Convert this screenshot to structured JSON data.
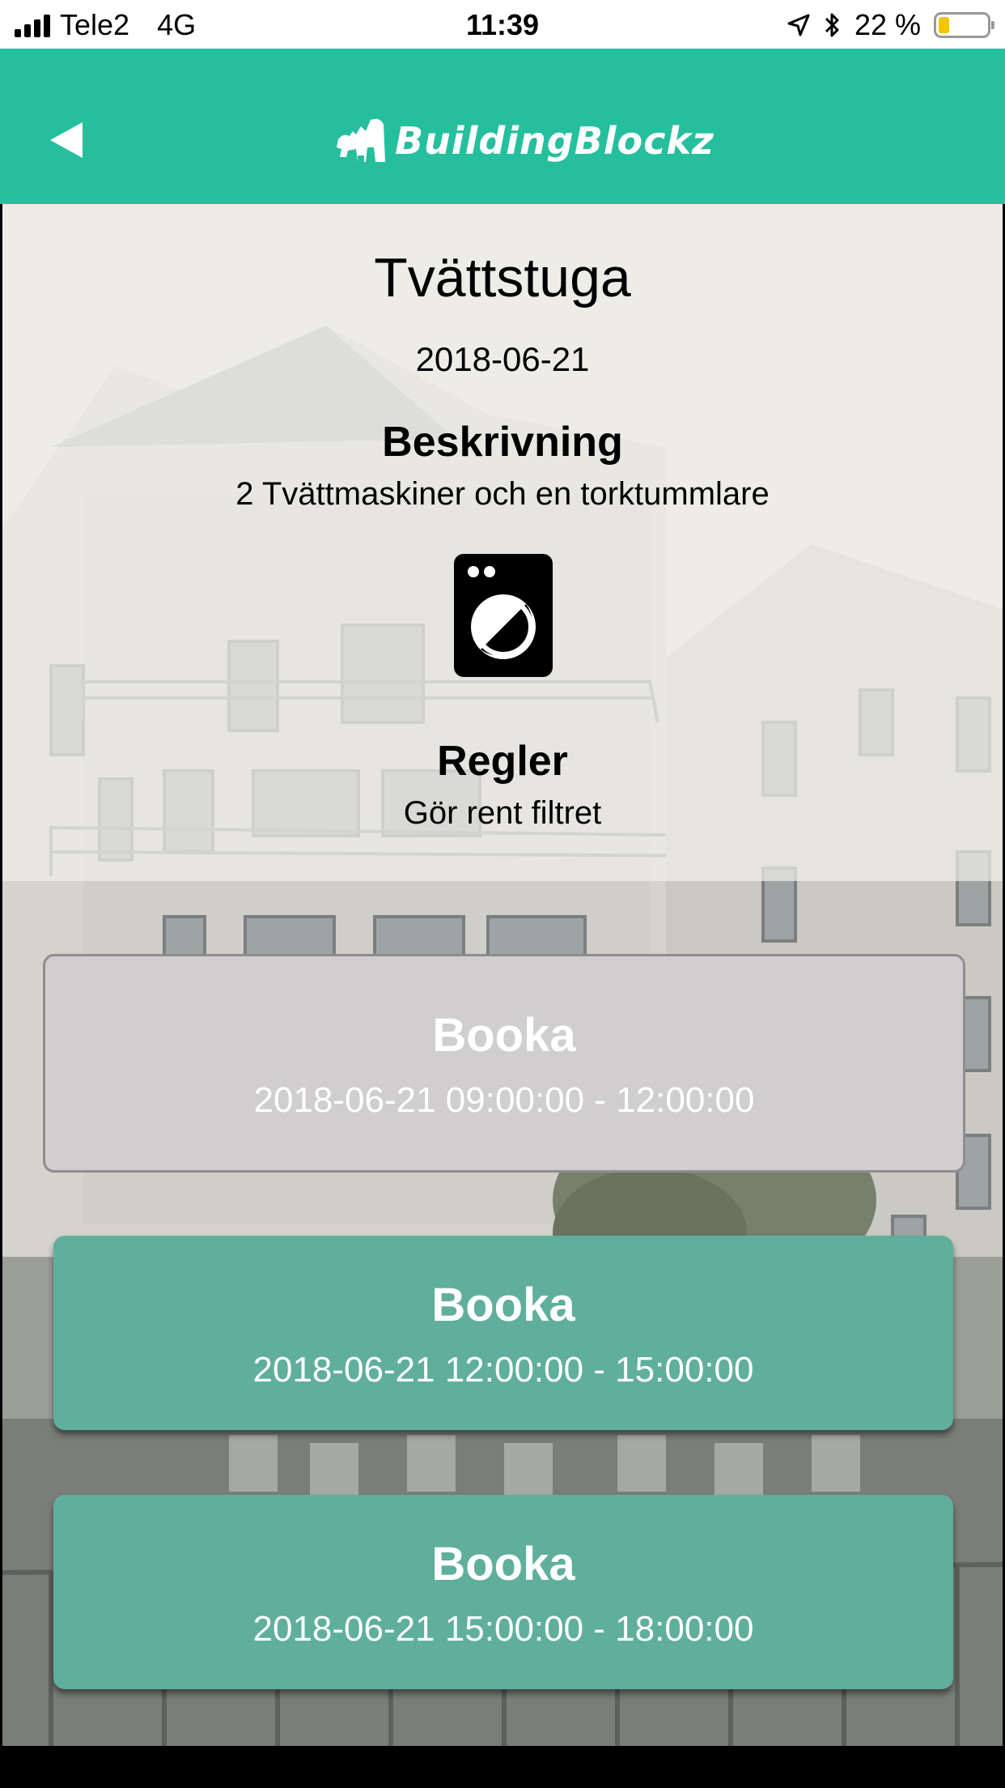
{
  "status_bar": {
    "carrier": "Tele2",
    "network": "4G",
    "time": "11:39",
    "battery": "22 %",
    "battery_level": 0.22
  },
  "header": {
    "logo_text": "BuildingBlockz",
    "accent_color": "#25bf9e"
  },
  "facility": {
    "title": "Tvättstuga",
    "date": "2018-06-21",
    "description_heading": "Beskrivning",
    "description": "2 Tvättmaskiner och en torktummlare",
    "rules_heading": "Regler",
    "rules": "Gör rent filtret"
  },
  "slots": [
    {
      "label": "Booka",
      "time": "2018-06-21 09:00:00 - 12:00:00",
      "state": "disabled"
    },
    {
      "label": "Booka",
      "time": "2018-06-21 12:00:00 - 15:00:00",
      "state": "available"
    },
    {
      "label": "Booka",
      "time": "2018-06-21 15:00:00 - 18:00:00",
      "state": "available"
    }
  ]
}
